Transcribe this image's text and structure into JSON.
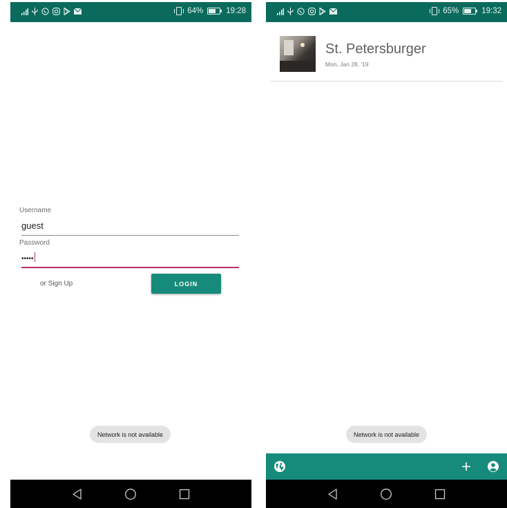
{
  "colors": {
    "status_bar": "#0a6b5c",
    "primary": "#178b7b",
    "accent": "#b8306a",
    "toast_bg": "#e3e3e3",
    "nav_bar": "#000000"
  },
  "left_screen": {
    "status_bar": {
      "icons": [
        "signal-icon",
        "usb-icon",
        "whatsapp-icon",
        "instagram-icon",
        "play-store-icon",
        "mail-icon"
      ],
      "battery_percent": "64%",
      "battery_level": 0.64,
      "time": "19:28"
    },
    "form": {
      "username_label": "Username",
      "username_value": "guest",
      "password_label": "Password",
      "password_value": "•••••",
      "signup_text": "or Sign Up",
      "login_label": "LOGIN"
    },
    "toast": "Network is not available"
  },
  "right_screen": {
    "status_bar": {
      "icons": [
        "signal-icon",
        "usb-icon",
        "whatsapp-icon",
        "instagram-icon",
        "play-store-icon",
        "mail-icon"
      ],
      "battery_percent": "65%",
      "battery_level": 0.65,
      "time": "19:32"
    },
    "list": [
      {
        "title": "St. Petersburger",
        "date": "Mon, Jan 28, '19"
      }
    ],
    "toast": "Network is not available",
    "toolbar": {
      "icons": [
        "globe-icon",
        "plus-icon",
        "account-icon"
      ]
    }
  },
  "nav_bar": {
    "icons": [
      "back-icon",
      "home-icon",
      "recents-icon"
    ]
  }
}
